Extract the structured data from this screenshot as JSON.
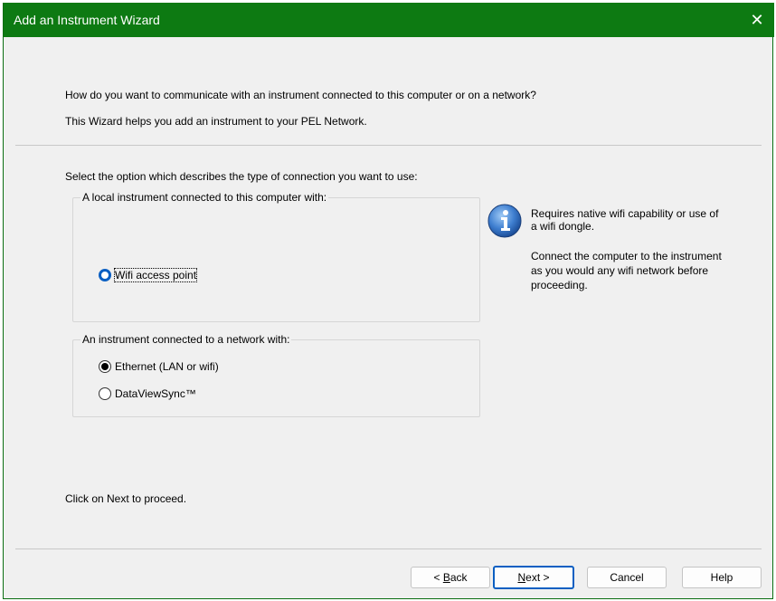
{
  "window": {
    "title": "Add an Instrument Wizard",
    "close_glyph": "✕"
  },
  "intro": {
    "question": "How do you want to communicate with an instrument connected to this computer or on a network?",
    "description": "This Wizard helps you add an instrument to your PEL Network."
  },
  "select_prompt": "Select the option which describes the type of connection you want to use:",
  "local_group": {
    "legend": "A local instrument connected to this computer with:",
    "options": [
      {
        "label": "Wifi access point",
        "checked": false,
        "focused": true
      }
    ]
  },
  "network_group": {
    "legend": "An instrument connected to a network with:",
    "options": [
      {
        "label": "Ethernet (LAN or wifi)",
        "checked": true
      },
      {
        "label": "DataViewSync™",
        "checked": false
      }
    ]
  },
  "info": {
    "icon": "info-icon",
    "line1": "Requires native wifi capability or use of",
    "line2": "a wifi dongle.",
    "line3": "Connect the computer to the instrument",
    "line4": "as you would any wifi network before",
    "line5": "proceeding."
  },
  "footer_text": "Click on Next to proceed.",
  "buttons": {
    "back_prefix": "< ",
    "back_mnemonic": "B",
    "back_rest": "ack",
    "next_mnemonic": "N",
    "next_rest": "ext >",
    "cancel": "Cancel",
    "help": "Help"
  },
  "colors": {
    "titlebar": "#0d7a12",
    "focus": "#0a5fc2"
  }
}
